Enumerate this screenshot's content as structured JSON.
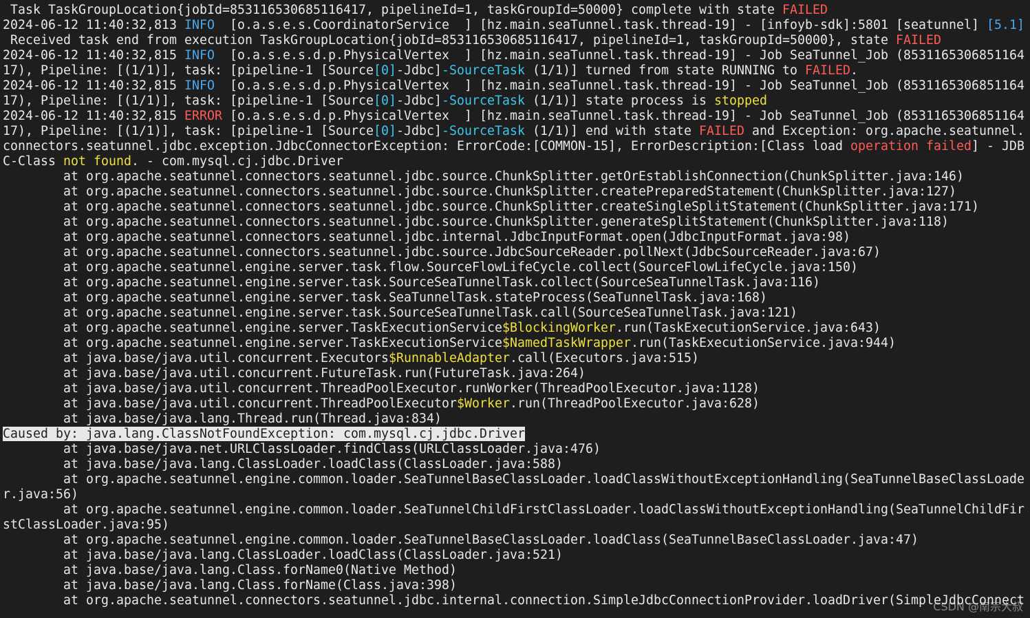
{
  "colors": {
    "background": "#1e1e1e",
    "text": "#e8e8e8",
    "failed_red": "#ff5c57",
    "info_blue": "#4aa8f0",
    "class_cyan": "#3cc6ec",
    "keyword_yellow": "#f0e040"
  },
  "lines": [
    [
      {
        "t": " Task TaskGroupLocation{jobId=853116530685116417, pipelineId=1, taskGroupId=50000} complete with state "
      },
      {
        "t": "FAILED",
        "c": "red"
      }
    ],
    [
      {
        "t": "2024-06-12 11:40:32,813 "
      },
      {
        "t": "INFO",
        "c": "blue"
      },
      {
        "t": "  [o.a.s.e.s.CoordinatorService  ] [hz.main.seaTunnel.task.thread-19] - [infoyb-sdk]:5801 [seatunnel] "
      },
      {
        "t": "[5.1]",
        "c": "blue"
      }
    ],
    [
      {
        "t": " Received task end from execution TaskGroupLocation{jobId=853116530685116417, pipelineId=1, taskGroupId=50000}, state "
      },
      {
        "t": "FAILED",
        "c": "red"
      }
    ],
    [
      {
        "t": "2024-06-12 11:40:32,815 "
      },
      {
        "t": "INFO",
        "c": "blue"
      },
      {
        "t": "  [o.a.s.e.s.d.p.PhysicalVertex  ] [hz.main.seaTunnel.task.thread-19] - Job SeaTunnel_Job (8531165306851164"
      }
    ],
    [
      {
        "t": "17), Pipeline: [(1/1)], task: [pipeline-1 [Source"
      },
      {
        "t": "[0]",
        "c": "cyan"
      },
      {
        "t": "-Jdbc]"
      },
      {
        "t": "-SourceTask",
        "c": "cyan"
      },
      {
        "t": " (1/1)] turned from state RUNNING to "
      },
      {
        "t": "FAILED",
        "c": "red"
      },
      {
        "t": "."
      }
    ],
    [
      {
        "t": "2024-06-12 11:40:32,815 "
      },
      {
        "t": "INFO",
        "c": "blue"
      },
      {
        "t": "  [o.a.s.e.s.d.p.PhysicalVertex  ] [hz.main.seaTunnel.task.thread-19] - Job SeaTunnel_Job (8531165306851164"
      }
    ],
    [
      {
        "t": "17), Pipeline: [(1/1)], task: [pipeline-1 [Source"
      },
      {
        "t": "[0]",
        "c": "cyan"
      },
      {
        "t": "-Jdbc]"
      },
      {
        "t": "-SourceTask",
        "c": "cyan"
      },
      {
        "t": " (1/1)] state process is "
      },
      {
        "t": "stopped",
        "c": "yellow"
      }
    ],
    [
      {
        "t": "2024-06-12 11:40:32,815 "
      },
      {
        "t": "ERROR",
        "c": "red"
      },
      {
        "t": " [o.a.s.e.s.d.p.PhysicalVertex  ] [hz.main.seaTunnel.task.thread-19] - Job SeaTunnel_Job (8531165306851164"
      }
    ],
    [
      {
        "t": "17), Pipeline: [(1/1)], task: [pipeline-1 [Source"
      },
      {
        "t": "[0]",
        "c": "cyan"
      },
      {
        "t": "-Jdbc]"
      },
      {
        "t": "-SourceTask",
        "c": "cyan"
      },
      {
        "t": " (1/1)] end with state "
      },
      {
        "t": "FAILED",
        "c": "red"
      },
      {
        "t": " and Exception: org.apache.seatunnel."
      }
    ],
    [
      {
        "t": "connectors.seatunnel.jdbc.exception.JdbcConnectorException: ErrorCode:[COMMON-15], ErrorDescription:[Class load "
      },
      {
        "t": "operation failed",
        "c": "red"
      },
      {
        "t": "] - JDB"
      }
    ],
    [
      {
        "t": "C-Class "
      },
      {
        "t": "not found",
        "c": "yellow"
      },
      {
        "t": ". - com.mysql.cj.jdbc.Driver"
      }
    ],
    [
      {
        "t": "        at org.apache.seatunnel.connectors.seatunnel.jdbc.source.ChunkSplitter.getOrEstablishConnection(ChunkSplitter.java:146)"
      }
    ],
    [
      {
        "t": "        at org.apache.seatunnel.connectors.seatunnel.jdbc.source.ChunkSplitter.createPreparedStatement(ChunkSplitter.java:127)"
      }
    ],
    [
      {
        "t": "        at org.apache.seatunnel.connectors.seatunnel.jdbc.source.ChunkSplitter.createSingleSplitStatement(ChunkSplitter.java:171)"
      }
    ],
    [
      {
        "t": "        at org.apache.seatunnel.connectors.seatunnel.jdbc.source.ChunkSplitter.generateSplitStatement(ChunkSplitter.java:118)"
      }
    ],
    [
      {
        "t": "        at org.apache.seatunnel.connectors.seatunnel.jdbc.internal.JdbcInputFormat.open(JdbcInputFormat.java:98)"
      }
    ],
    [
      {
        "t": "        at org.apache.seatunnel.connectors.seatunnel.jdbc.source.JdbcSourceReader.pollNext(JdbcSourceReader.java:67)"
      }
    ],
    [
      {
        "t": "        at org.apache.seatunnel.engine.server.task.flow.SourceFlowLifeCycle.collect(SourceFlowLifeCycle.java:150)"
      }
    ],
    [
      {
        "t": "        at org.apache.seatunnel.engine.server.task.SourceSeaTunnelTask.collect(SourceSeaTunnelTask.java:116)"
      }
    ],
    [
      {
        "t": "        at org.apache.seatunnel.engine.server.task.SeaTunnelTask.stateProcess(SeaTunnelTask.java:168)"
      }
    ],
    [
      {
        "t": "        at org.apache.seatunnel.engine.server.task.SourceSeaTunnelTask.call(SourceSeaTunnelTask.java:121)"
      }
    ],
    [
      {
        "t": "        at org.apache.seatunnel.engine.server.TaskExecutionService"
      },
      {
        "t": "$BlockingWorker",
        "c": "yellow"
      },
      {
        "t": ".run(TaskExecutionService.java:643)"
      }
    ],
    [
      {
        "t": "        at org.apache.seatunnel.engine.server.TaskExecutionService"
      },
      {
        "t": "$NamedTaskWrapper",
        "c": "yellow"
      },
      {
        "t": ".run(TaskExecutionService.java:944)"
      }
    ],
    [
      {
        "t": "        at java.base/java.util.concurrent.Executors"
      },
      {
        "t": "$RunnableAdapter",
        "c": "yellow"
      },
      {
        "t": ".call(Executors.java:515)"
      }
    ],
    [
      {
        "t": "        at java.base/java.util.concurrent.FutureTask.run(FutureTask.java:264)"
      }
    ],
    [
      {
        "t": "        at java.base/java.util.concurrent.ThreadPoolExecutor.runWorker(ThreadPoolExecutor.java:1128)"
      }
    ],
    [
      {
        "t": "        at java.base/java.util.concurrent.ThreadPoolExecutor"
      },
      {
        "t": "$Worker",
        "c": "yellow"
      },
      {
        "t": ".run(ThreadPoolExecutor.java:628)"
      }
    ],
    [
      {
        "t": "        at java.base/java.lang.Thread.run(Thread.java:834)"
      }
    ],
    [
      {
        "t": "Caused by: java.lang.ClassNotFoundException: com.mysql.cj.jdbc.Driver",
        "c": "caused"
      }
    ],
    [
      {
        "t": "        at java.base/java.net.URLClassLoader.findClass(URLClassLoader.java:476)"
      }
    ],
    [
      {
        "t": "        at java.base/java.lang.ClassLoader.loadClass(ClassLoader.java:588)"
      }
    ],
    [
      {
        "t": "        at org.apache.seatunnel.engine.common.loader.SeaTunnelBaseClassLoader.loadClassWithoutExceptionHandling(SeaTunnelBaseClassLoade"
      }
    ],
    [
      {
        "t": "r.java:56)"
      }
    ],
    [
      {
        "t": "        at org.apache.seatunnel.engine.common.loader.SeaTunnelChildFirstClassLoader.loadClassWithoutExceptionHandling(SeaTunnelChildFir"
      }
    ],
    [
      {
        "t": "stClassLoader.java:95)"
      }
    ],
    [
      {
        "t": "        at org.apache.seatunnel.engine.common.loader.SeaTunnelBaseClassLoader.loadClass(SeaTunnelBaseClassLoader.java:47)"
      }
    ],
    [
      {
        "t": "        at java.base/java.lang.ClassLoader.loadClass(ClassLoader.java:521)"
      }
    ],
    [
      {
        "t": "        at java.base/java.lang.Class.forName0(Native Method)"
      }
    ],
    [
      {
        "t": "        at java.base/java.lang.Class.forName(Class.java:398)"
      }
    ],
    [
      {
        "t": "        at org.apache.seatunnel.connectors.seatunnel.jdbc.internal.connection.SimpleJdbcConnectionProvider.loadDriver(SimpleJdbcConnect"
      }
    ]
  ],
  "watermark": "CSDN @南宗大叔"
}
